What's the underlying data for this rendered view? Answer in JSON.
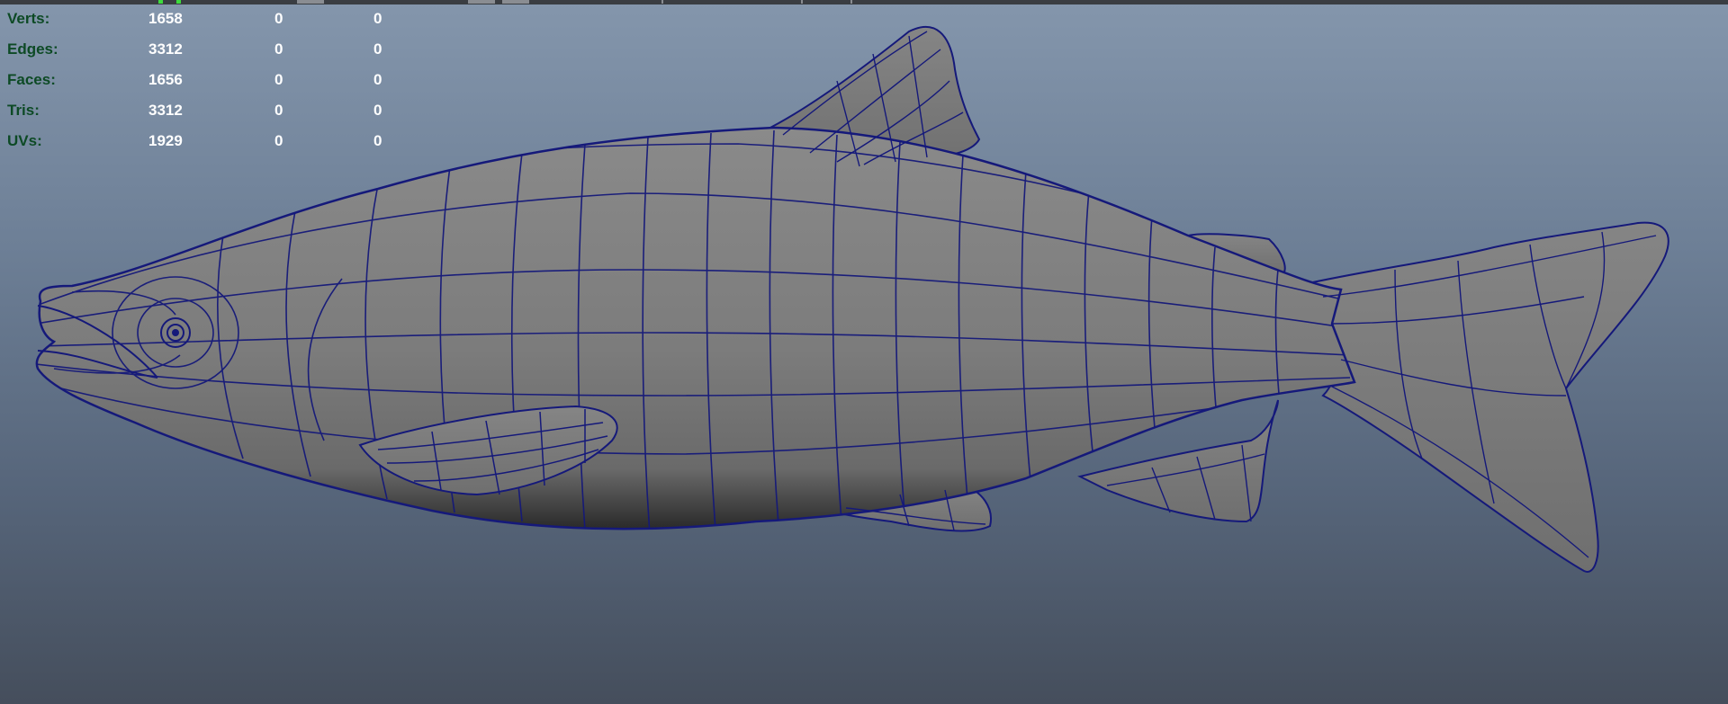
{
  "hud": {
    "rows": [
      {
        "label": "Verts:",
        "values": [
          "1658",
          "0",
          "0"
        ]
      },
      {
        "label": "Edges:",
        "values": [
          "3312",
          "0",
          "0"
        ]
      },
      {
        "label": "Faces:",
        "values": [
          "1656",
          "0",
          "0"
        ]
      },
      {
        "label": "Tris:",
        "values": [
          "3312",
          "0",
          "0"
        ]
      },
      {
        "label": "UVs:",
        "values": [
          "1929",
          "0",
          "0"
        ]
      }
    ]
  },
  "colors": {
    "hud_label": "#0d4a25",
    "hud_value": "#ffffff",
    "wire": "#15197a",
    "shade": "#7a7a7a"
  }
}
